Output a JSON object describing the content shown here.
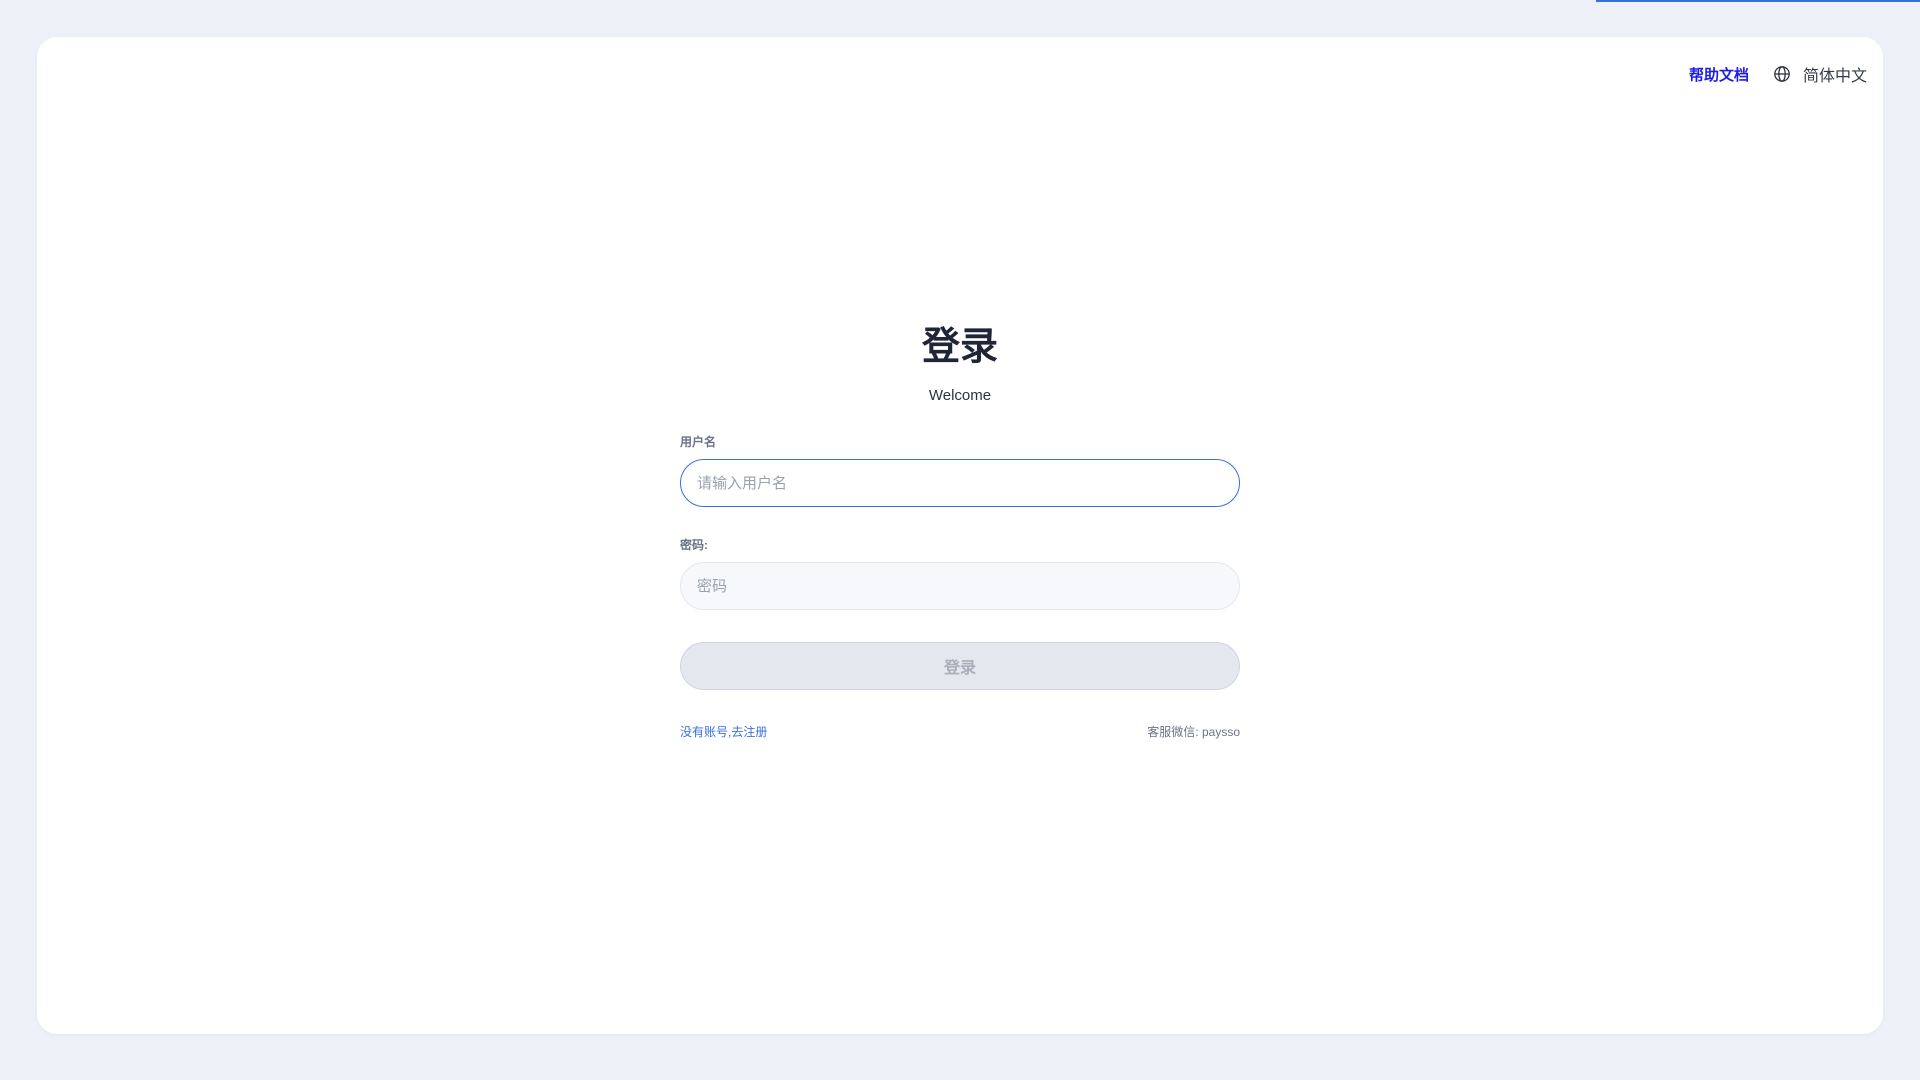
{
  "header": {
    "help_link": "帮助文档",
    "language": "简体中文",
    "language_icon": "globe-icon"
  },
  "login": {
    "title": "登录",
    "subtitle": "Welcome",
    "username_label": "用户名",
    "username_placeholder": "请输入用户名",
    "username_value": "",
    "password_label": "密码:",
    "password_placeholder": "密码",
    "password_value": "",
    "submit_label": "登录",
    "register_link": "没有账号,去注册",
    "support_text": "客服微信: paysso"
  },
  "colors": {
    "accent": "#3b6fe0",
    "help_link": "#1d1de8",
    "page_background": "#edf0f6",
    "card_background": "#ffffff"
  }
}
